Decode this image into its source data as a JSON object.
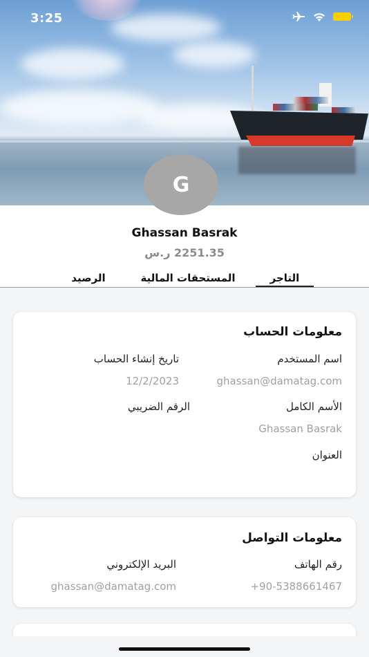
{
  "status_bar": {
    "time": "3:25",
    "airplane_icon": "airplane-icon",
    "wifi_icon": "wifi-icon",
    "battery_icon": "battery-icon"
  },
  "profile": {
    "avatar_letter": "G",
    "name": "Ghassan Basrak",
    "balance": "2251.35 ر.س"
  },
  "tabs": [
    {
      "label": "التاجر",
      "active": true
    },
    {
      "label": "المستحقات المالية",
      "active": false
    },
    {
      "label": "الرصيد",
      "active": false
    }
  ],
  "account_info": {
    "title": "معلومات الحساب",
    "username_label": "اسم المستخدم",
    "username_value": "ghassan@damatag.com",
    "created_label": "تاريخ إنشاء الحساب",
    "created_value": "12/2/2023",
    "fullname_label": "الأسم الكامل",
    "fullname_value": "Ghassan Basrak",
    "tax_label": "الرقم الضريبي",
    "address_label": "العنوان"
  },
  "contact_info": {
    "title": "معلومات التواصل",
    "phone_label": "رقم الهاتف",
    "phone_value": "+90-5388661467",
    "email_label": "البريد الإلكتروني",
    "email_value": "ghassan@damatag.com"
  },
  "colors": {
    "accent": "#111111",
    "muted": "#a0a0a0",
    "avatar": "#a7a7a7",
    "battery": "#f4d000"
  }
}
